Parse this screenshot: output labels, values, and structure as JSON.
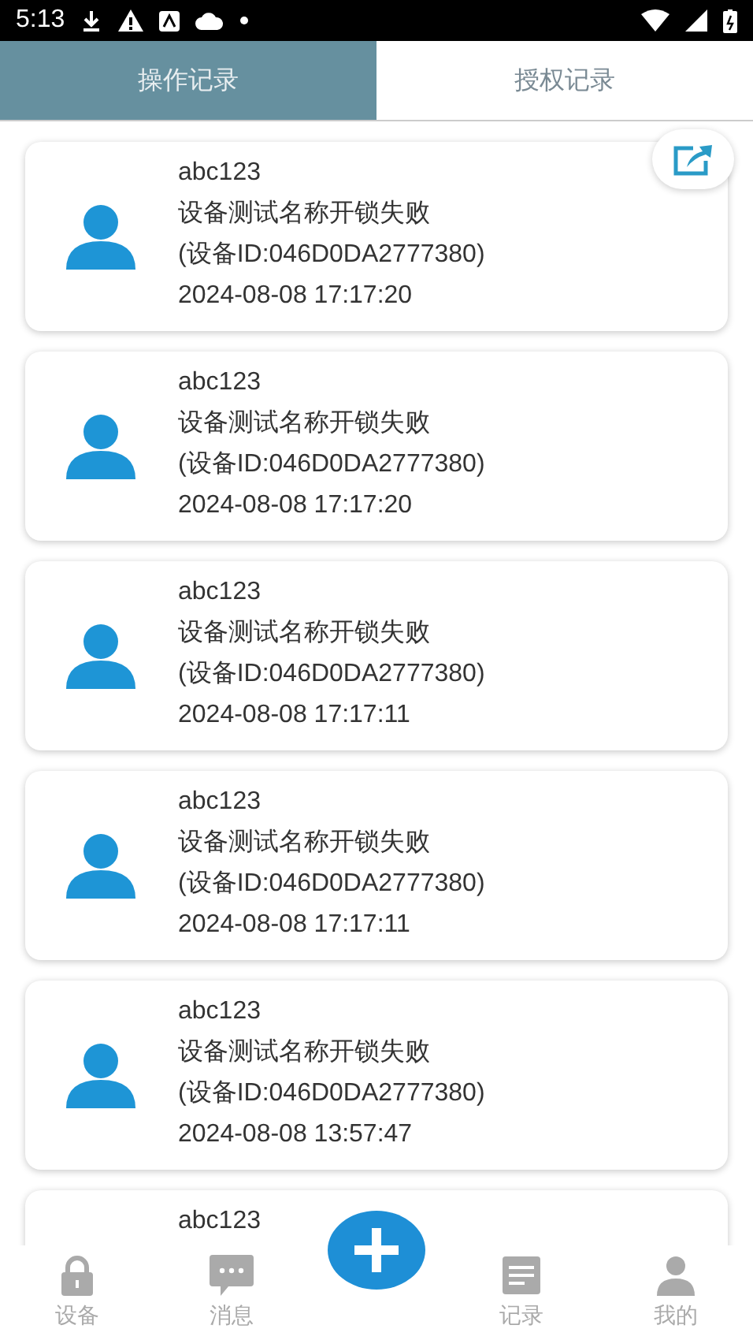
{
  "status_bar": {
    "time": "5:13"
  },
  "tabs": [
    {
      "label": "操作记录",
      "selected": true
    },
    {
      "label": "授权记录",
      "selected": false
    }
  ],
  "records": [
    {
      "user": "abc123",
      "message": "设备测试名称开锁失败",
      "device": "(设备ID:046D0DA2777380)",
      "time": "2024-08-08 17:17:20"
    },
    {
      "user": "abc123",
      "message": "设备测试名称开锁失败",
      "device": "(设备ID:046D0DA2777380)",
      "time": "2024-08-08 17:17:20"
    },
    {
      "user": "abc123",
      "message": "设备测试名称开锁失败",
      "device": "(设备ID:046D0DA2777380)",
      "time": "2024-08-08 17:17:11"
    },
    {
      "user": "abc123",
      "message": "设备测试名称开锁失败",
      "device": "(设备ID:046D0DA2777380)",
      "time": "2024-08-08 17:17:11"
    },
    {
      "user": "abc123",
      "message": "设备测试名称开锁失败",
      "device": "(设备ID:046D0DA2777380)",
      "time": "2024-08-08 13:57:47"
    },
    {
      "user": "abc123"
    }
  ],
  "nav": [
    {
      "kind": "lock",
      "label": "设备"
    },
    {
      "kind": "chat",
      "label": "消息"
    },
    {
      "kind": "add"
    },
    {
      "kind": "list",
      "label": "记录"
    },
    {
      "kind": "person",
      "label": "我的"
    }
  ]
}
